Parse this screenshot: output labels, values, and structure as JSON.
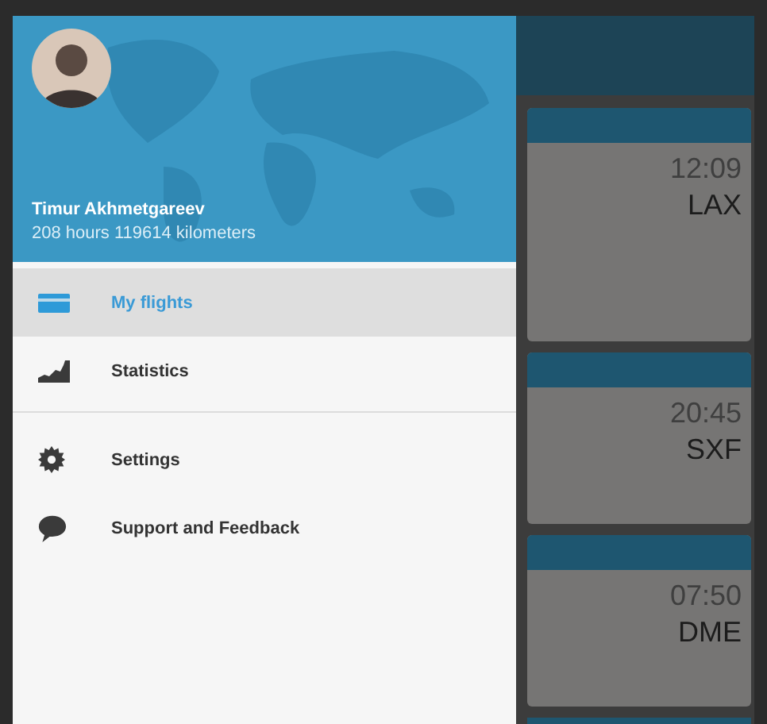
{
  "user": {
    "name": "Timur Akhmetgareev",
    "stats": "208 hours 119614 kilometers"
  },
  "menu_groups": [
    [
      {
        "label": "My flights",
        "selected": true
      },
      {
        "label": "Statistics",
        "selected": false
      }
    ],
    [
      {
        "label": "Settings",
        "selected": false
      },
      {
        "label": "Support and Feedback",
        "selected": false
      }
    ]
  ],
  "flights": [
    {
      "time": "12:09",
      "airport": "LAX"
    },
    {
      "time": "20:45",
      "airport": "SXF"
    },
    {
      "time": "07:50",
      "airport": "DME"
    }
  ]
}
